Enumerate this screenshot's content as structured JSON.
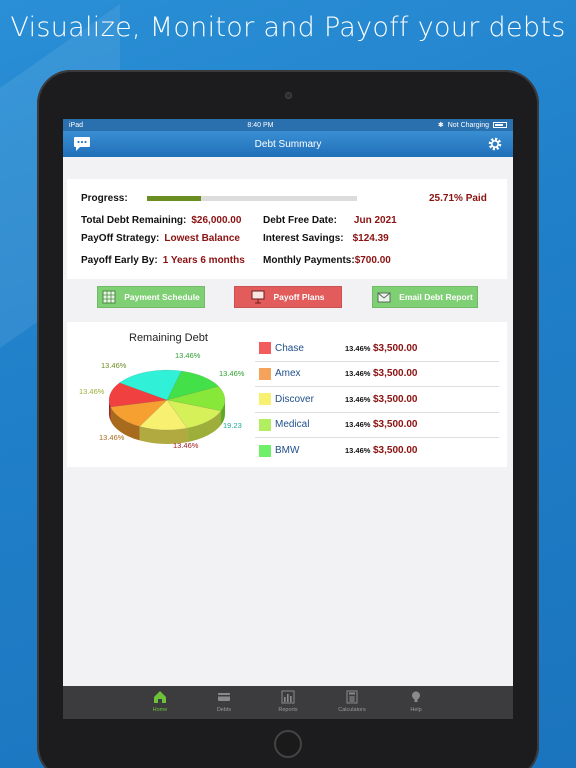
{
  "headline": "Visualize, Monitor and Payoff your debts",
  "status": {
    "carrier": "iPad",
    "time": "8:40 PM",
    "charging": "Not Charging"
  },
  "nav": {
    "title": "Debt Summary",
    "left_icon": "chat-bubble-icon",
    "right_icon": "gear-icon"
  },
  "summary": {
    "progress_label": "Progress:",
    "progress_value": 0.2571,
    "paid_text": "25.71% Paid",
    "total_label": "Total Debt Remaining:",
    "total_value": "$26,000.00",
    "free_date_label": "Debt Free Date:",
    "free_date_value": "Jun 2021",
    "strategy_label": "PayOff Strategy:",
    "strategy_value": "Lowest Balance",
    "savings_label": "Interest Savings:",
    "savings_value": "$124.39",
    "early_label": "Payoff Early By:",
    "early_value": "1 Years 6 months",
    "monthly_label": "Monthly Payments:",
    "monthly_value": "$700.00"
  },
  "buttons": {
    "schedule": "Payment Schedule",
    "plans": "Payoff Plans",
    "email": "Email Debt Report"
  },
  "colors": {
    "schedule": "#7fcf74",
    "plans": "#e25c5c",
    "email": "#7fcf74",
    "value_red": "#8b1111",
    "progress": "#6b8e23"
  },
  "chart_data": {
    "type": "pie",
    "title": "Remaining Debt",
    "slice_labels": [
      "13.46%",
      "13.46%",
      "13.46%",
      "19.23",
      "13.46%",
      "13.46%",
      "13.46%"
    ],
    "legend": [
      {
        "name": "Chase",
        "pct": "13.46%",
        "amount": "$3,500.00",
        "color": "#f25c5c"
      },
      {
        "name": "Amex",
        "pct": "13.46%",
        "amount": "$3,500.00",
        "color": "#f5a25a"
      },
      {
        "name": "Discover",
        "pct": "13.46%",
        "amount": "$3,500.00",
        "color": "#f7f070"
      },
      {
        "name": "Medical",
        "pct": "13.46%",
        "amount": "$3,500.00",
        "color": "#b2ef60"
      },
      {
        "name": "BMW",
        "pct": "13.46%",
        "amount": "$3,500.00",
        "color": "#6ef069"
      }
    ]
  },
  "tabs": [
    {
      "label": "Home",
      "icon": "home-icon",
      "active": true
    },
    {
      "label": "Debts",
      "icon": "credit-card-icon",
      "active": false
    },
    {
      "label": "Reports",
      "icon": "bar-chart-icon",
      "active": false
    },
    {
      "label": "Calculators",
      "icon": "calculator-icon",
      "active": false
    },
    {
      "label": "Help",
      "icon": "lightbulb-icon",
      "active": false
    }
  ]
}
